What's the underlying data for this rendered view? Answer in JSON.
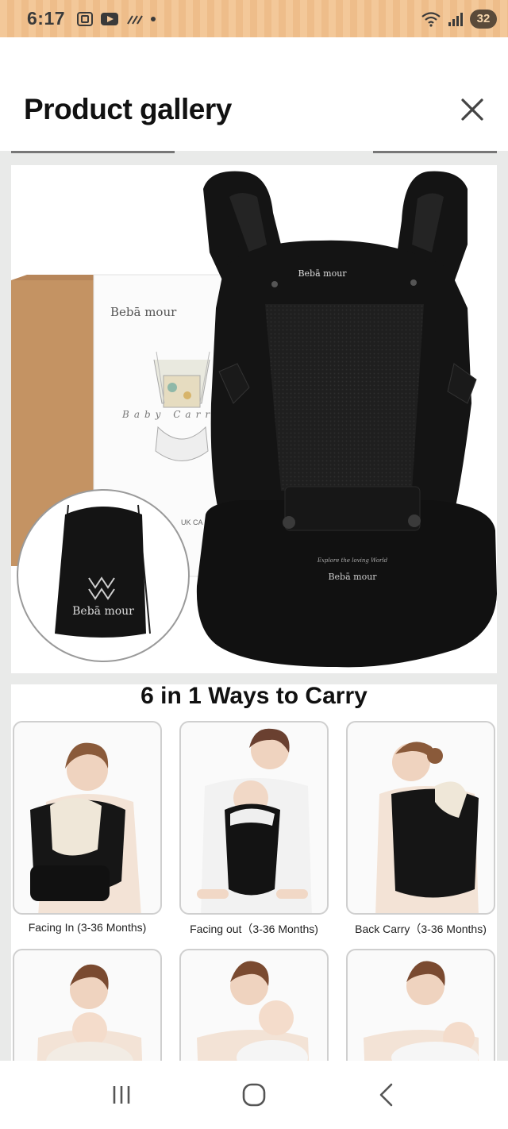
{
  "status_bar": {
    "time": "6:17",
    "battery": "32",
    "icons": [
      "screenshot-icon",
      "youtube-icon",
      "data-saver-icon",
      "dot-icon",
      "wifi-icon",
      "signal-icon",
      "battery-icon"
    ]
  },
  "header": {
    "title": "Product gallery",
    "close_icon": "close-icon"
  },
  "gallery": {
    "image_1": {
      "carrier_brand": "Bebamour",
      "carrier_brand_display": "Bebā mour",
      "carrier_tagline": "Explore the loving World",
      "box_brand": "Bebā mour",
      "box_label": "Baby Carrier",
      "box_marks": "UK CA",
      "bag_brand": "Bebā mour"
    },
    "image_2": {
      "title": "6 in 1 Ways to Carry",
      "captions": [
        "Facing In (3-36 Months)",
        "Facing out（3-36 Months)",
        "Back Carry（3-36 Months)"
      ]
    }
  },
  "nav": {
    "recents": "recents-icon",
    "home": "home-icon",
    "back": "back-icon"
  },
  "colors": {
    "status_bar": "#f3c899",
    "carrier": "#141414",
    "background": "#e9eae9"
  }
}
